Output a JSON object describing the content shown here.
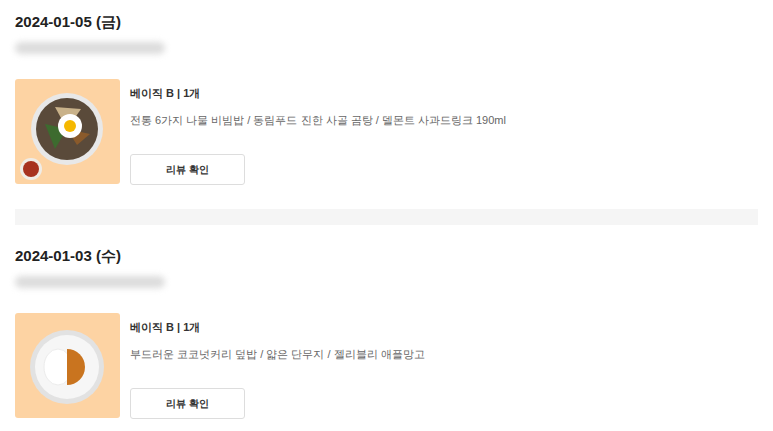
{
  "orders": [
    {
      "date": "2024-01-05 (금)",
      "product": "베이직 B | 1개",
      "items": "전통 6가지 나물 비빔밥 / 동림푸드 진한 사골 곰탕 / 델몬트 사과드링크 190ml",
      "button": "리뷰 확인",
      "kind": "bibimbap"
    },
    {
      "date": "2024-01-03 (수)",
      "product": "베이직 B | 1개",
      "items": "부드러운 코코넛커리 덮밥 / 얇은 단무지 / 젤리블리 애플망고",
      "button": "리뷰 확인",
      "kind": "curry"
    }
  ]
}
